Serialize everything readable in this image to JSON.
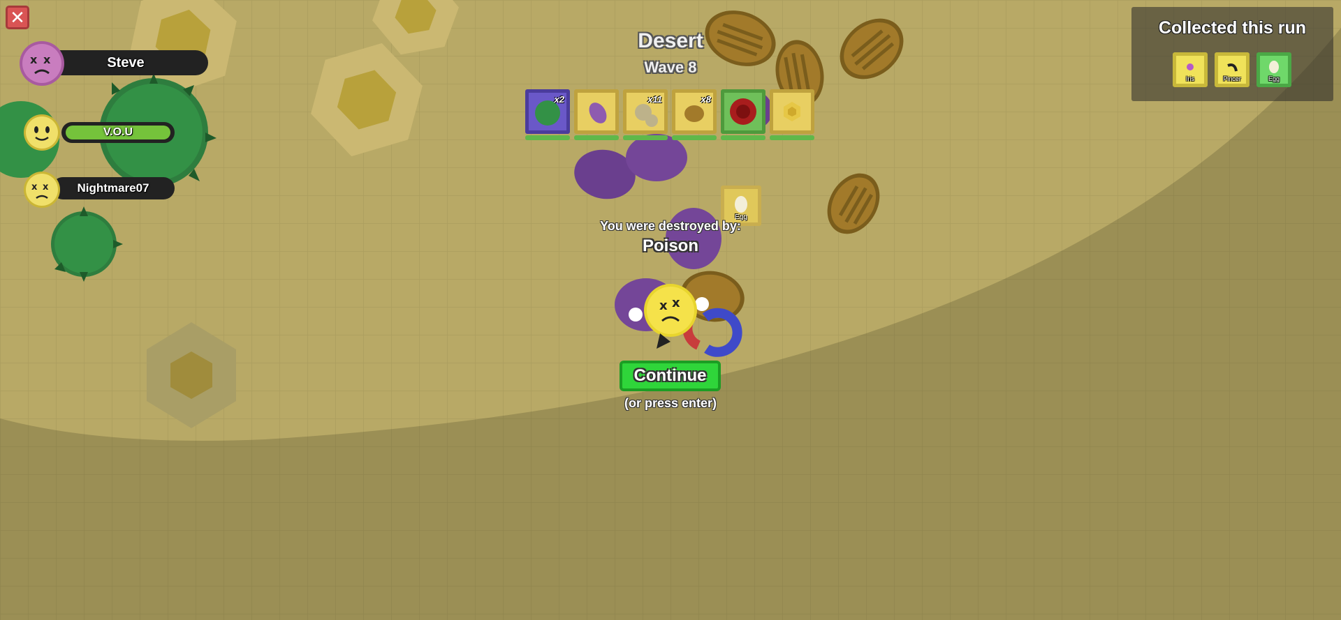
{
  "hud": {
    "close_icon": "close-icon",
    "biome": "Desert",
    "wave": "Wave 8"
  },
  "players": [
    {
      "name": "Steve",
      "state": "dead",
      "color": "#c97dbf"
    },
    {
      "name": "V.O.U",
      "state": "alive",
      "color": "#f0e06a",
      "health": 1.0
    },
    {
      "name": "Nightmare07",
      "state": "dead",
      "color": "#f0e06a"
    }
  ],
  "loadout": [
    {
      "icon": "cactus-petal-icon",
      "count": "x2",
      "rarity_color": "#5c4ab7"
    },
    {
      "icon": "beetle-petal-icon",
      "count": "",
      "rarity_color": "#e2c653"
    },
    {
      "icon": "ant-petal-icon",
      "count": "x11",
      "rarity_color": "#e2c653"
    },
    {
      "icon": "beetle-petal-icon",
      "count": "x8",
      "rarity_color": "#e2c653"
    },
    {
      "icon": "rose-petal-icon",
      "count": "",
      "rarity_color": "#6fc05a"
    },
    {
      "icon": "honey-petal-icon",
      "count": "",
      "rarity_color": "#e2c653"
    }
  ],
  "death": {
    "message": "You were destroyed by:",
    "killer": "Poison",
    "continue_label": "Continue",
    "hint": "(or press enter)"
  },
  "drop": {
    "label": "Egg",
    "icon": "egg-icon"
  },
  "collected": {
    "title": "Collected this run",
    "items": [
      {
        "label": "Iris",
        "icon": "iris-icon",
        "color": "#f0e25a"
      },
      {
        "label": "Pincer",
        "icon": "pincer-icon",
        "color": "#f0e25a"
      },
      {
        "label": "Egg",
        "icon": "egg-icon",
        "color": "#6fd86a"
      }
    ]
  }
}
